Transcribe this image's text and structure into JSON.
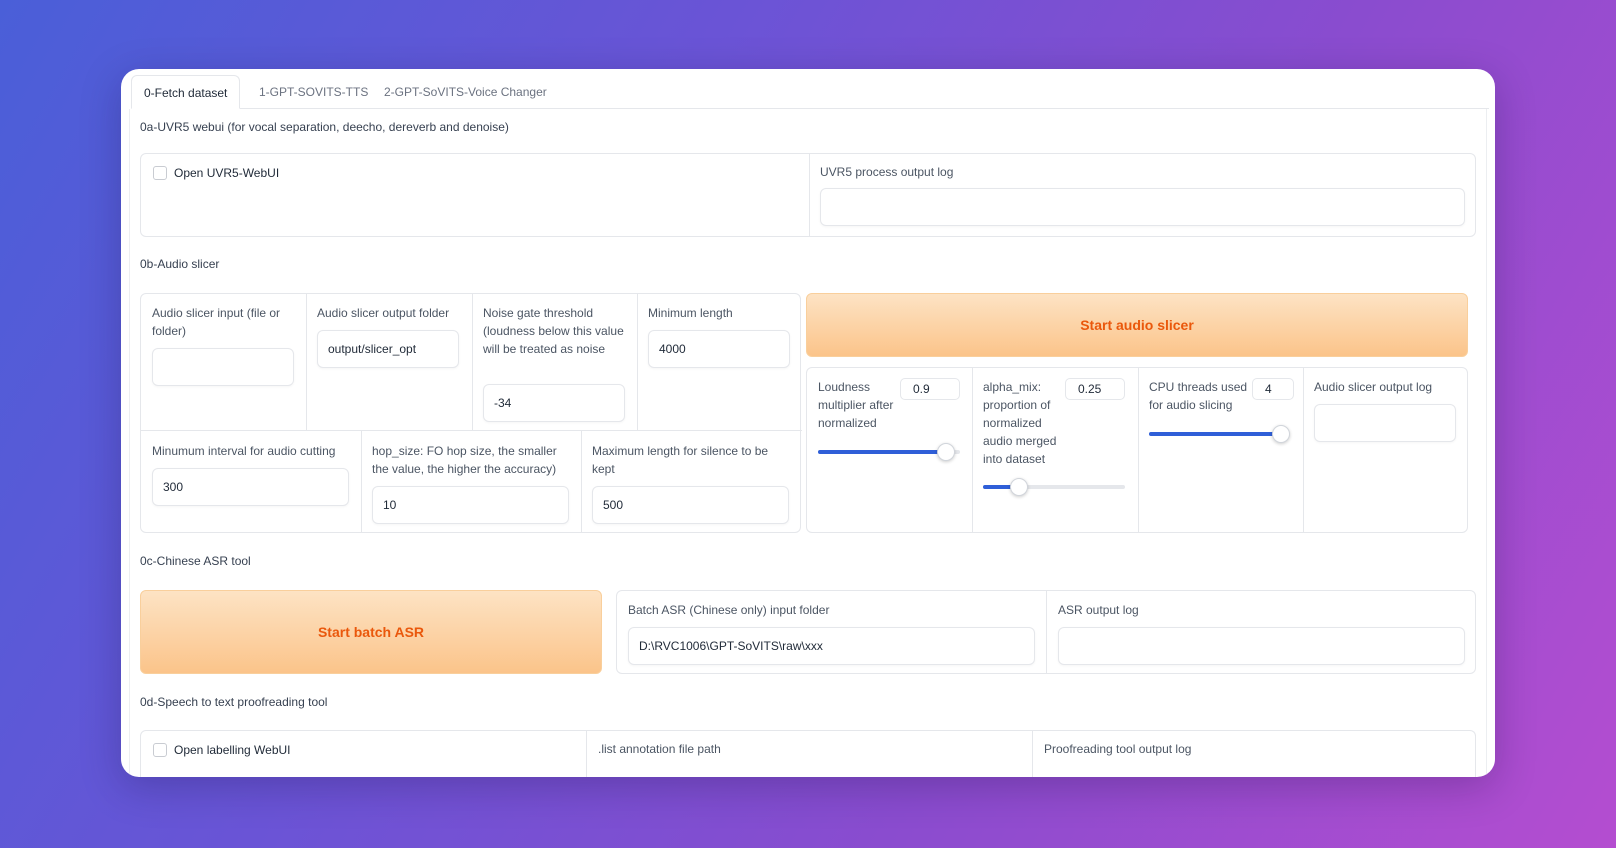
{
  "tabs": [
    {
      "label": "0-Fetch dataset"
    },
    {
      "label": "1-GPT-SOVITS-TTS"
    },
    {
      "label": "2-GPT-SoVITS-Voice Changer"
    }
  ],
  "uvr5": {
    "title": "0a-UVR5 webui (for vocal separation, deecho, dereverb and denoise)",
    "checkbox_label": "Open UVR5-WebUI",
    "log_label": "UVR5 process output log",
    "log_value": ""
  },
  "slicer": {
    "title": "0b-Audio slicer",
    "input_label": "Audio slicer input (file or folder)",
    "input_value": "",
    "output_folder_label": "Audio slicer output folder",
    "output_folder_value": "output/slicer_opt",
    "threshold_label": "Noise gate threshold (loudness below this value will be treated as noise",
    "threshold_value": "-34",
    "min_length_label": "Minimum length",
    "min_length_value": "4000",
    "min_interval_label": "Minumum interval for audio cutting",
    "min_interval_value": "300",
    "hop_size_label": "hop_size: FO hop size, the smaller the value, the higher the accuracy)",
    "hop_size_value": "10",
    "max_sil_label": "Maximum length for silence to be kept",
    "max_sil_value": "500",
    "start_button": "Start audio slicer",
    "loudness_label": "Loudness multiplier after normalized",
    "loudness_value": "0.9",
    "loudness_fraction": 0.9,
    "alpha_label": "alpha_mix: proportion of normalized audio merged into dataset",
    "alpha_value": "0.25",
    "alpha_fraction": 0.25,
    "threads_label": "CPU threads used for audio slicing",
    "threads_value": "4",
    "threads_fraction": 1.0,
    "log_label": "Audio slicer output log",
    "log_value": ""
  },
  "asr": {
    "title": "0c-Chinese ASR tool",
    "start_button": "Start batch ASR",
    "input_label": "Batch ASR (Chinese only) input folder",
    "input_value": "D:\\RVC1006\\GPT-SoVITS\\raw\\xxx",
    "log_label": "ASR output log",
    "log_value": ""
  },
  "proof": {
    "title": "0d-Speech to text proofreading tool",
    "checkbox_label": "Open labelling WebUI",
    "list_label": ".list annotation file path",
    "log_label": "Proofreading tool output log"
  },
  "colors": {
    "accent_blue": "#2f5fd8",
    "button_orange_text": "#ea580c"
  }
}
